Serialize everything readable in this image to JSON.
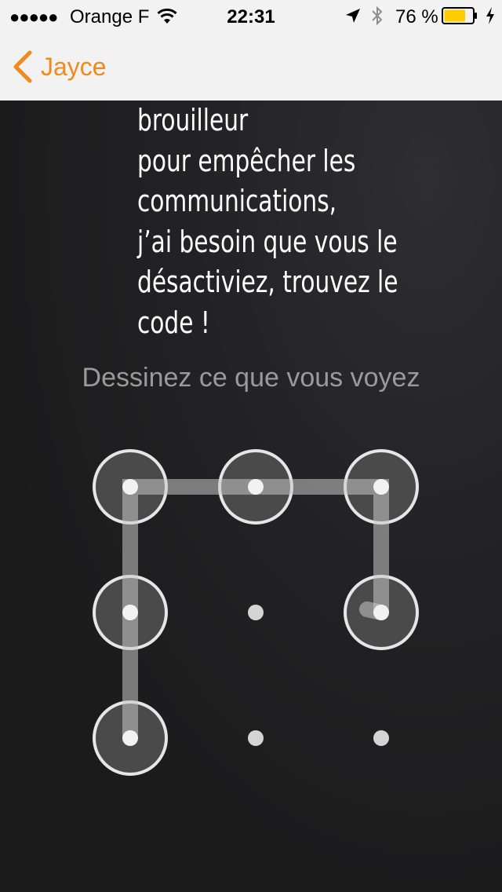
{
  "status_bar": {
    "signal": "●●●●●",
    "carrier": "Orange F",
    "time": "22:31",
    "battery_percent": "76 %",
    "battery_level": 0.76,
    "battery_color": "#ffcc00",
    "icons": [
      "wifi-icon",
      "location-arrow-icon",
      "bluetooth-icon",
      "battery-icon",
      "charging-bolt-icon"
    ]
  },
  "nav": {
    "back_label": "Jayce",
    "accent_color": "#f08a1c",
    "back_icon": "chevron-left-icon"
  },
  "message": {
    "lines": [
      "brouilleur",
      "pour empêcher les",
      "communications,",
      "j’ai besoin que vous le",
      "désactiviez, trouvez le",
      "code !"
    ]
  },
  "instruction": "Dessinez ce que vous voyez",
  "pattern": {
    "grid_size": 3,
    "dots": [
      {
        "id": 1,
        "active": true
      },
      {
        "id": 2,
        "active": true
      },
      {
        "id": 3,
        "active": true
      },
      {
        "id": 4,
        "active": true
      },
      {
        "id": 5,
        "active": false
      },
      {
        "id": 6,
        "active": true
      },
      {
        "id": 7,
        "active": true
      },
      {
        "id": 8,
        "active": false
      },
      {
        "id": 9,
        "active": false
      }
    ],
    "path": [
      7,
      4,
      1,
      2,
      3,
      6
    ]
  }
}
